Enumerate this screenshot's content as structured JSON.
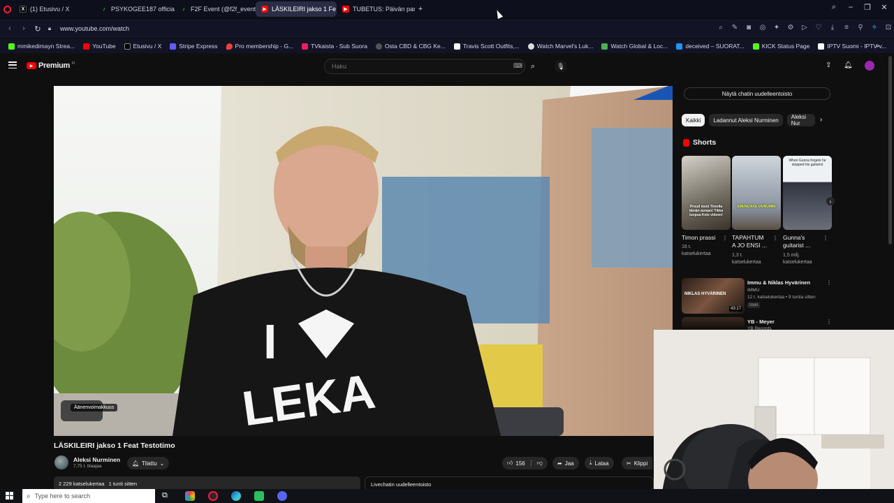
{
  "browser": {
    "tabs": [
      {
        "label": "(1) Etusivu / X",
        "icon": "x-logo-icon",
        "color": "#ffffff"
      },
      {
        "label": "PSYKOGEE187 official (@",
        "icon": "tiktok-icon",
        "color": "#25f4ee"
      },
      {
        "label": "F2F Event (@f2f_event) |",
        "icon": "tiktok-icon",
        "color": "#25f4ee"
      },
      {
        "label": "LÄSKILEIRI jakso 1 Fe",
        "icon": "youtube-icon",
        "color": "#ff0000"
      },
      {
        "label": "TUBETUS: Päivän parhaat",
        "icon": "youtube-icon",
        "color": "#ff0000"
      }
    ],
    "url": "www.youtube.com/watch",
    "bookmarks": [
      {
        "label": "mmikedimayn Strea...",
        "color": "#53fc18"
      },
      {
        "label": "YouTube",
        "color": "#ff0000"
      },
      {
        "label": "Etusivu / X",
        "color": "#ffffff"
      },
      {
        "label": "Stripe Express",
        "color": "#635bff"
      },
      {
        "label": "Pro membership - G...",
        "color": "#ea4335"
      },
      {
        "label": "TVkaista - Sub Suora",
        "color": "#e91e63"
      },
      {
        "label": "Osta CBD & CBG Ke...",
        "color": "#888888"
      },
      {
        "label": "Travis Scott Outfits,...",
        "color": "#ffffff"
      },
      {
        "label": "Watch Marvel's Luk...",
        "color": "#dddddd"
      },
      {
        "label": "Watch Global & Loc...",
        "color": "#4caf50"
      },
      {
        "label": "deceived – SUORAT...",
        "color": "#2196f3"
      },
      {
        "label": "KICK Status Page",
        "color": "#53fc18"
      },
      {
        "label": "IPTV Suomi - IPTV-v...",
        "color": "#ffffff"
      }
    ]
  },
  "youtube": {
    "logo_text": "Premium",
    "logo_sup": "FI",
    "search_placeholder": "Haku",
    "video": {
      "title": "LÄSKILEIRI jakso 1 Feat Testotimo",
      "overlay_label": "Äänenvoimakkuus",
      "channel_name": "Aleksi Nurminen",
      "subscribers": "7,75 t. tilaajaa",
      "subscribe_label": "Tilattu",
      "likes": "156",
      "share_label": "Jaa",
      "download_label": "Lataa",
      "clip_label": "Klippi",
      "views": "2 229 katselukertaa",
      "time": "1 tunti sitten",
      "chat_replay_bottom": "Livechatin uudelleentoisto"
    },
    "sidebar": {
      "chat_replay_button": "Näytä chatin uudelleentoisto",
      "chips": [
        "Kaikki",
        "Ladannut Aleksi Nurminen",
        "Aleksi Nur"
      ],
      "shorts_heading": "Shorts",
      "shorts": [
        {
          "title_lines": [
            "Timon prassi"
          ],
          "meta_lines": [
            "16 t.",
            "katselukertaa"
          ],
          "thumb_text": "Proud meni Timolla tämän auraan! Tikka luopua Kelo videon!"
        },
        {
          "title_lines": [
            "TAPAHTUM",
            "A JO ENSI ..."
          ],
          "meta_lines": [
            "1,3 t.",
            "katselukertaa"
          ],
          "thumb_text": "SMUNDAKE VAINUMMI"
        },
        {
          "title_lines": [
            "Gunna's",
            "guitarist ..."
          ],
          "meta_lines": [
            "1,5 milj.",
            "katselukertaa"
          ],
          "thumb_text": "When Gunna forgets he stopped his guitarist"
        }
      ],
      "videos": [
        {
          "title": "Immu & Niklas Hyvärinen",
          "channel": "IMMU",
          "meta": "12 t. katselukertaa • 9 tuntia sitten",
          "badge": "Uusi",
          "duration": "43:17",
          "thumb_text": "NIKLAS HYVÄRINEN"
        },
        {
          "title": "YB - Meyer",
          "channel": "YB Records",
          "meta": "",
          "badge": "",
          "duration": "",
          "thumb_text": ""
        }
      ]
    }
  },
  "taskbar": {
    "search_placeholder": "Type here to search"
  },
  "colors": {
    "yt_red": "#ff0000",
    "bg": "#0f0f0f",
    "browser_bg": "#121426"
  }
}
